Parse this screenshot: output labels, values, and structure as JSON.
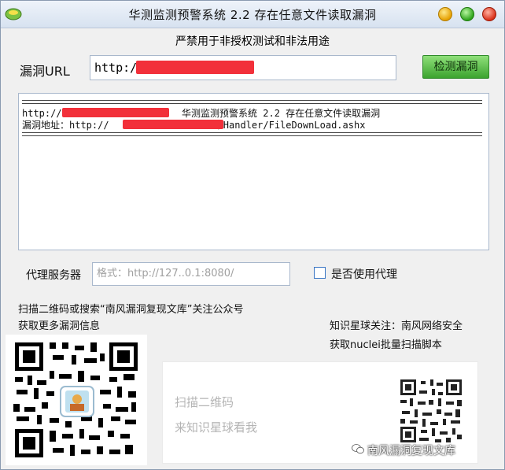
{
  "window": {
    "title": "华测监测预警系统 2.2 存在任意文件读取漏洞",
    "warning": "严禁用于非授权测试和非法用途"
  },
  "form": {
    "url_label": "漏洞URL",
    "url_value": "http://",
    "detect_button": "检测漏洞",
    "proxy_label": "代理服务器",
    "proxy_placeholder": "格式：http://127..0.1:8080/",
    "use_proxy_label": "是否使用代理",
    "use_proxy_checked": false
  },
  "output": {
    "line1_prefix": "http://",
    "line1_suffix": "华测监测预警系统 2.2 存在任意文件读取漏洞",
    "line2_prefix": "漏洞地址：http://",
    "line2_suffix": "/Handler/FileDownLoad.ashx"
  },
  "promo": {
    "line1": "扫描二维码或搜索“南风漏洞复现文库”关注公众号",
    "line2": "获取更多漏洞信息",
    "planet_line1": "知识星球关注：南风网络安全",
    "planet_line2": "获取nuclei批量扫描脚本",
    "card_line1": "扫描二维码",
    "card_line2": "来知识星球看我"
  },
  "watermark": {
    "text": "南风漏洞复现文库"
  },
  "colors": {
    "redaction": "#f2303a",
    "button_green": "#3ba32f",
    "input_border": "#a9b8cc"
  }
}
